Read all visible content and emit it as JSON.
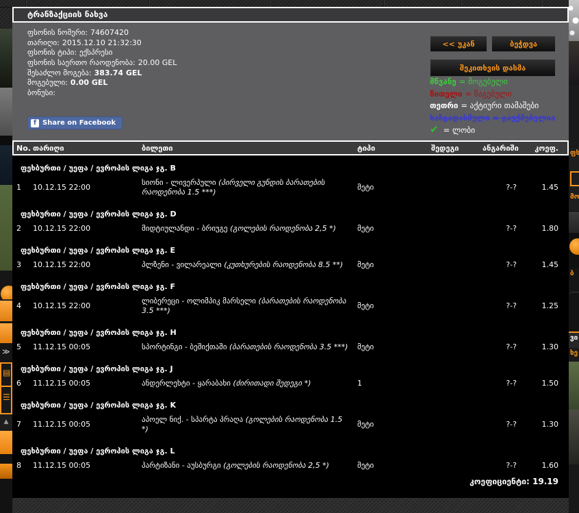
{
  "window": {
    "title": "ტრანზაქციის ნახვა"
  },
  "info": {
    "lines": [
      {
        "label": "ფსონის ნომერი:",
        "value": "74607420",
        "bold": false
      },
      {
        "label": "თარიღი:",
        "value": "2015.12.10 21:32:30",
        "bold": false
      },
      {
        "label": "ფსონის ტიპი:",
        "value": "ექსპრესი",
        "bold": false
      },
      {
        "label": "ფსონის საერთო რაოდენობა:",
        "value": "20.00 GEL",
        "bold": false
      },
      {
        "label": "შესაძლო მოგება:",
        "value": "383.74 GEL",
        "bold": true
      },
      {
        "label": "მოგებული:",
        "value": "0.00 GEL",
        "bold": true
      },
      {
        "label": "ბონუსი:",
        "value": "",
        "bold": false
      }
    ],
    "facebook_button": "Share on Facebook"
  },
  "actions": {
    "back": "<< უკან",
    "print": "ბეჭდვა",
    "ask_question": "შეკითხვის დასმა"
  },
  "legend": {
    "items": [
      {
        "term": "მწვანე",
        "rest": "= მოგებული",
        "color": "#3ecc3e",
        "strike": false,
        "icon": ""
      },
      {
        "term": "წითელი",
        "rest": "= წაგებული",
        "color": "#a81111",
        "strike": false,
        "icon": ""
      },
      {
        "term": "თეთრი",
        "rest": "= აქტიური თამაშები",
        "color": "#ffffff",
        "strike": false,
        "icon": ""
      },
      {
        "term": "ხაზგადასმული",
        "rest": "= გაუქმებულია",
        "color": "#3a3ace",
        "strike": true,
        "icon": ""
      },
      {
        "term": "",
        "rest": "= ლობი",
        "color": "#ffffff",
        "strike": false,
        "icon": "check"
      }
    ]
  },
  "table": {
    "headers": {
      "no": "No.",
      "date": "თარიღი",
      "ticket": "ბილეთი",
      "type": "ტიპი",
      "result": "შედეგი",
      "score": "ანგარიში",
      "coef": "კოეფ."
    },
    "groups": [
      {
        "league": "ფეხბურთი / უეფა / ევროპის ლიგა ჯგ. B",
        "rows": [
          {
            "no": "1",
            "date": "10.12.15 22:00",
            "match": "სიონი - ლივერპული",
            "market": "(პირველი გუნდის ბარათების რაოდენობა 1.5 ***)",
            "type": "მეტი",
            "result": "",
            "score": "?-?",
            "coef": "1.45"
          }
        ]
      },
      {
        "league": "ფეხბურთი / უეფა / ევროპის ლიგა ჯგ. D",
        "rows": [
          {
            "no": "2",
            "date": "10.12.15 22:00",
            "match": "მიდტიულანდი - ბრიუგე",
            "market": "(გოლების რაოდენობა 2,5 *)",
            "type": "მეტი",
            "result": "",
            "score": "?-?",
            "coef": "1.80"
          }
        ]
      },
      {
        "league": "ფეხბურთი / უეფა / ევროპის ლიგა ჯგ. E",
        "rows": [
          {
            "no": "3",
            "date": "10.12.15 22:00",
            "match": "პლზენი - ვილარეალი",
            "market": "(კუთხურების რაოდენობა 8.5 **)",
            "type": "მეტი",
            "result": "",
            "score": "?-?",
            "coef": "1.45"
          }
        ]
      },
      {
        "league": "ფეხბურთი / უეფა / ევროპის ლიგა ჯგ. F",
        "rows": [
          {
            "no": "4",
            "date": "10.12.15 22:00",
            "match": "ლიბერეცი - ოლიმპიკ მარსელი",
            "market": "(ბარათების რაოდენობა 3.5 ***)",
            "type": "მეტი",
            "result": "",
            "score": "?-?",
            "coef": "1.25"
          }
        ]
      },
      {
        "league": "ფეხბურთი / უეფა / ევროპის ლიგა ჯგ. H",
        "rows": [
          {
            "no": "5",
            "date": "11.12.15 00:05",
            "match": "სპორტინგი - ბეშიქთაში",
            "market": "(ბარათების რაოდენობა 3.5 ***)",
            "type": "მეტი",
            "result": "",
            "score": "?-?",
            "coef": "1.30"
          }
        ]
      },
      {
        "league": "ფეხბურთი / უეფა / ევროპის ლიგა ჯგ. J",
        "rows": [
          {
            "no": "6",
            "date": "11.12.15 00:05",
            "match": "ანდერლეხტი - ყარაბახი",
            "market": "(ძირითადი შედეგი *)",
            "type": "1",
            "result": "",
            "score": "?-?",
            "coef": "1.50"
          }
        ]
      },
      {
        "league": "ფეხბურთი / უეფა / ევროპის ლიგა ჯგ. K",
        "rows": [
          {
            "no": "7",
            "date": "11.12.15 00:05",
            "match": "აპოელ ნიქ. - სპარტა პრაღა",
            "market": "(გოლების რაოდენობა 1.5 *)",
            "type": "მეტი",
            "result": "",
            "score": "?-?",
            "coef": "1.30"
          }
        ]
      },
      {
        "league": "ფეხბურთი / უეფა / ევროპის ლიგა ჯგ. L",
        "rows": [
          {
            "no": "8",
            "date": "11.12.15 00:05",
            "match": "პარტიზანი - აუსბურგი",
            "market": "(გოლების რაოდენობა 2,5 *)",
            "type": "მეტი",
            "result": "",
            "score": "?-?",
            "coef": "1.60"
          }
        ]
      }
    ],
    "footer": {
      "label": "კოეფიციენტი:",
      "value": "19.19"
    }
  },
  "edges": {
    "right_fragments": [
      "ფს",
      "მო",
      "ბ",
      "ვი",
      "ხე"
    ]
  },
  "colors": {
    "accent": "#f7941d",
    "facebook_blue": "#4e69a2",
    "won_green": "#3ecc3e",
    "lost_red": "#a81111",
    "cancelled_blue": "#3a3ace"
  }
}
